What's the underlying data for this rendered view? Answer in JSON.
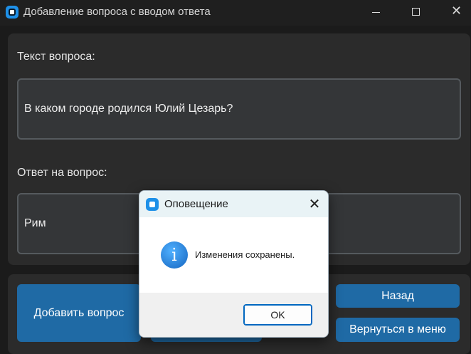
{
  "window": {
    "title": "Добавление вопроса с вводом ответа",
    "minimize_icon": "minimize-icon",
    "maximize_icon": "maximize-icon",
    "close_icon": "close-icon",
    "close_glyph": "✕"
  },
  "form": {
    "question_label": "Текст вопроса:",
    "question_value": "В каком городе родился Юлий Цезарь?",
    "answer_label": "Ответ на вопрос:",
    "answer_value": "Рим"
  },
  "actions": {
    "add_label": "Добавить вопрос",
    "back_label": "Назад",
    "menu_label": "Вернуться в меню"
  },
  "dialog": {
    "title": "Оповещение",
    "close_glyph": "✕",
    "icon": "info-icon",
    "icon_glyph": "i",
    "message": "Изменения сохранены.",
    "ok_label": "OK"
  },
  "colors": {
    "accent": "#1f6aa5",
    "background": "#1b1b1b",
    "panel": "#2b2b2b",
    "field": "#343638"
  }
}
